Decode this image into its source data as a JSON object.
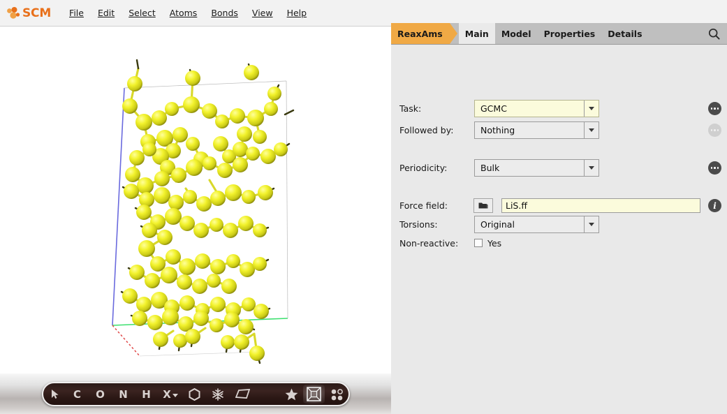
{
  "app": {
    "brand": "SCM",
    "brand_color": "#e8701a"
  },
  "menubar": {
    "items": [
      {
        "label": "File",
        "accel": "F"
      },
      {
        "label": "Edit",
        "accel": "E"
      },
      {
        "label": "Select",
        "accel": "S"
      },
      {
        "label": "Atoms",
        "accel": "A"
      },
      {
        "label": "Bonds",
        "accel": "B"
      },
      {
        "label": "View",
        "accel": "V"
      },
      {
        "label": "Help",
        "accel": "H"
      }
    ]
  },
  "tabbar": {
    "breadcrumb": "ReaxAms",
    "breadcrumb_color": "#f0a945",
    "tabs": [
      {
        "label": "Main",
        "active": true
      },
      {
        "label": "Model",
        "active": false
      },
      {
        "label": "Properties",
        "active": false
      },
      {
        "label": "Details",
        "active": false
      }
    ],
    "search_icon": "search-icon"
  },
  "form": {
    "task": {
      "label": "Task:",
      "value": "GCMC",
      "highlighted": true,
      "options_button": "ellipsis-button",
      "options_enabled": true
    },
    "followed_by": {
      "label": "Followed by:",
      "value": "Nothing",
      "highlighted": false,
      "options_button": "ellipsis-button",
      "options_enabled": false
    },
    "periodicity": {
      "label": "Periodicity:",
      "value": "Bulk",
      "highlighted": false,
      "options_button": "ellipsis-button",
      "options_enabled": true
    },
    "force_field": {
      "label": "Force field:",
      "value": "LiS.ff",
      "browse_icon": "folder-icon",
      "info_icon": "info-icon"
    },
    "torsions": {
      "label": "Torsions:",
      "value": "Original",
      "highlighted": false
    },
    "non_reactive": {
      "label": "Non-reactive:",
      "checkbox_label": "Yes",
      "checked": false
    }
  },
  "toolbar": {
    "items": [
      {
        "name": "select-arrow-tool",
        "glyph": "arrow"
      },
      {
        "name": "carbon-atom-tool",
        "glyph": "C"
      },
      {
        "name": "oxygen-atom-tool",
        "glyph": "O"
      },
      {
        "name": "nitrogen-atom-tool",
        "glyph": "N"
      },
      {
        "name": "hydrogen-atom-tool",
        "glyph": "H"
      },
      {
        "name": "element-picker-tool",
        "glyph": "X"
      },
      {
        "name": "ring-tool",
        "glyph": "hexagon"
      },
      {
        "name": "snowflake-tool",
        "glyph": "snowflake"
      },
      {
        "name": "plane-tool",
        "glyph": "parallelogram"
      },
      {
        "name": "favorite-tool",
        "glyph": "star"
      },
      {
        "name": "crystal-box-tool",
        "glyph": "box",
        "selected": true
      },
      {
        "name": "grid-dots-tool",
        "glyph": "dots"
      }
    ]
  },
  "structure": {
    "atom_color": "#e8e82a",
    "axes": [
      {
        "name": "a-axis",
        "color": "#3a3ad0"
      },
      {
        "name": "b-axis",
        "color": "#2ee86a"
      },
      {
        "name": "c-axis",
        "color": "#e03030"
      }
    ]
  }
}
